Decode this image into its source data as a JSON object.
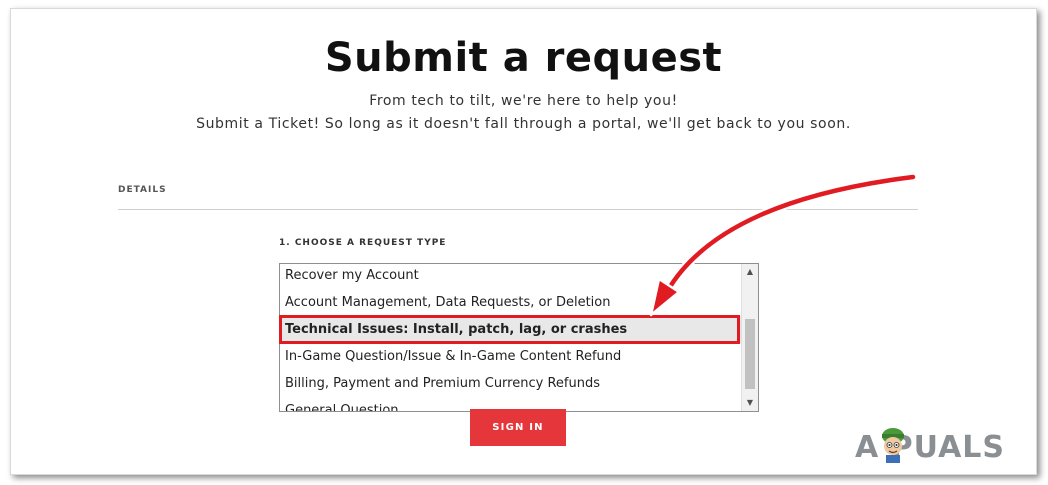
{
  "page": {
    "title": "Submit a request",
    "subtitle_line1": "From tech to tilt, we're here to help you!",
    "subtitle_line2": "Submit a Ticket! So long as it doesn't fall through a portal, we'll get back to you soon."
  },
  "details": {
    "section_label": "DETAILS"
  },
  "request_type": {
    "label": "1. CHOOSE A REQUEST TYPE",
    "options": [
      "Recover my Account",
      "Account Management, Data Requests, or Deletion",
      "Technical Issues: Install, patch, lag, or crashes",
      "In-Game Question/Issue & In-Game Content Refund",
      "Billing, Payment and Premium Currency Refunds",
      "General Question"
    ],
    "selected_index": 2
  },
  "sign_in_label": "SIGN IN",
  "watermark": {
    "text": "A  PUALS"
  },
  "colors": {
    "accent": "#e5363b",
    "highlight_border": "#e11b22",
    "selected_bg": "#e8e8e8"
  },
  "icons": {
    "scroll_up": "triangle-up-icon",
    "scroll_down": "triangle-down-icon",
    "annotation": "red-curved-arrow-icon"
  }
}
